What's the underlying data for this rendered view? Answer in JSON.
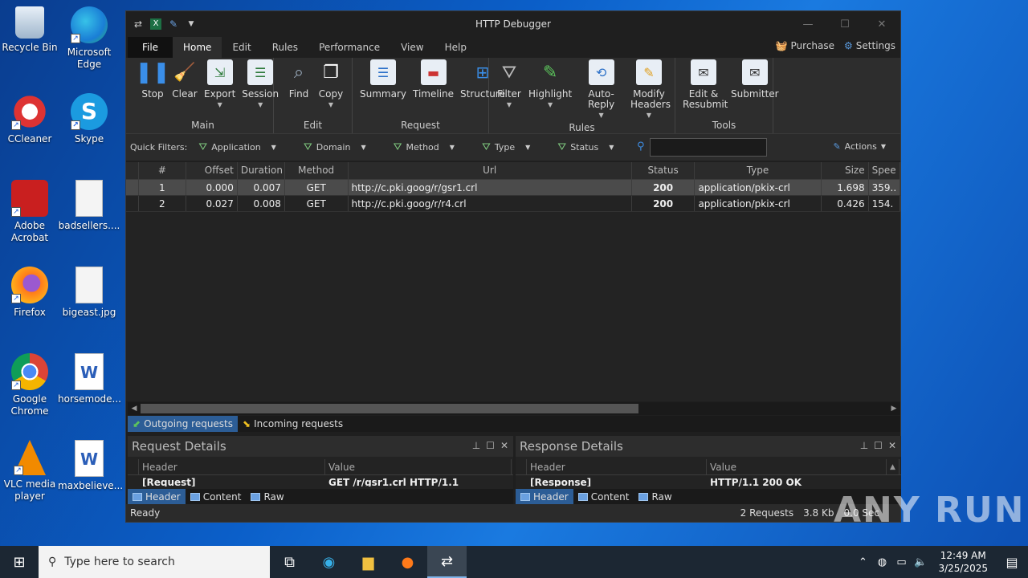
{
  "desktop": {
    "icons": [
      {
        "label": "Recycle Bin",
        "icon": "recycle-bin-icon"
      },
      {
        "label": "Microsoft Edge",
        "icon": "edge-icon"
      },
      {
        "label": "CCleaner",
        "icon": "ccleaner-icon"
      },
      {
        "label": "Skype",
        "icon": "skype-icon"
      },
      {
        "label": "Adobe Acrobat",
        "icon": "acrobat-icon"
      },
      {
        "label": "badsellers....",
        "icon": "image-file-icon"
      },
      {
        "label": "Firefox",
        "icon": "firefox-icon"
      },
      {
        "label": "bigeast.jpg",
        "icon": "image-file-icon"
      },
      {
        "label": "Google Chrome",
        "icon": "chrome-icon"
      },
      {
        "label": "horsemode...",
        "icon": "word-doc-icon"
      },
      {
        "label": "VLC media player",
        "icon": "vlc-icon"
      },
      {
        "label": "maxbelieve...",
        "icon": "word-doc-icon"
      }
    ]
  },
  "window": {
    "title": "HTTP Debugger",
    "tabs": [
      "File",
      "Home",
      "Edit",
      "Rules",
      "Performance",
      "View",
      "Help"
    ],
    "purchase": "Purchase",
    "settings": "Settings"
  },
  "ribbon": {
    "groups": [
      {
        "label": "Main",
        "buttons": [
          "Stop",
          "Clear",
          "Export",
          "Session"
        ]
      },
      {
        "label": "Edit",
        "buttons": [
          "Find",
          "Copy"
        ]
      },
      {
        "label": "Request",
        "buttons": [
          "Summary",
          "Timeline",
          "Structure"
        ]
      },
      {
        "label": "Rules",
        "buttons": [
          "Filter",
          "Highlight",
          "Auto-Reply",
          "Modify Headers"
        ]
      },
      {
        "label": "Tools",
        "buttons": [
          "Edit & Resubmit",
          "Submitter"
        ]
      }
    ]
  },
  "filters": {
    "label": "Quick Filters:",
    "items": [
      "Application",
      "Domain",
      "Method",
      "Type",
      "Status"
    ],
    "actions": "Actions"
  },
  "grid": {
    "columns": [
      "#",
      "Offset",
      "Duration",
      "Method",
      "Url",
      "Status",
      "Type",
      "Size",
      "Spee"
    ],
    "rows": [
      {
        "n": "1",
        "offset": "0.000",
        "duration": "0.007",
        "method": "GET",
        "url": "http://c.pki.goog/r/gsr1.crl",
        "status": "200",
        "type": "application/pkix-crl",
        "size": "1.698",
        "speed": "359.."
      },
      {
        "n": "2",
        "offset": "0.027",
        "duration": "0.008",
        "method": "GET",
        "url": "http://c.pki.goog/r/r4.crl",
        "status": "200",
        "type": "application/pkix-crl",
        "size": "0.426",
        "speed": "154."
      }
    ]
  },
  "request_tabs": [
    "Outgoing requests",
    "Incoming requests"
  ],
  "request_details": {
    "title": "Request Details",
    "col_header": "Header",
    "col_value": "Value",
    "row_header": "[Request]",
    "row_value": "GET /r/gsr1.crl HTTP/1.1",
    "tabs": [
      "Header",
      "Content",
      "Raw"
    ]
  },
  "response_details": {
    "title": "Response Details",
    "col_header": "Header",
    "col_value": "Value",
    "row_header": "[Response]",
    "row_value": "HTTP/1.1 200 OK",
    "tabs": [
      "Header",
      "Content",
      "Raw"
    ]
  },
  "status": {
    "left": "Ready",
    "requests": "2 Requests",
    "size": "3.8 Kb",
    "time": "0.0 Sec"
  },
  "taskbar": {
    "search_placeholder": "Type here to search",
    "time": "12:49 AM",
    "date": "3/25/2025"
  },
  "watermark": "ANY RUN"
}
